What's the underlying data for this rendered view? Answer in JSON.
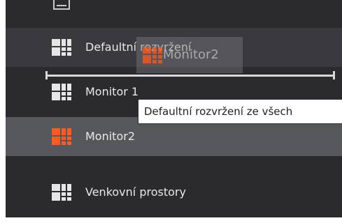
{
  "layouts": [
    {
      "label": "Defaultní rozvržení",
      "icon": "grid-layout-icon",
      "state": "normal"
    },
    {
      "label": "Monitor 1",
      "icon": "grid-layout-icon",
      "state": "normal"
    },
    {
      "label": "Monitor2",
      "icon": "grid-layout-icon",
      "state": "selected"
    },
    {
      "label": "Venkovní prostory",
      "icon": "grid-layout-icon",
      "state": "normal"
    }
  ],
  "drag_ghost": {
    "label": "Monitor2",
    "icon": "grid-layout-icon"
  },
  "tooltip": {
    "text": "Defaultní rozvržení ze všech"
  },
  "colors": {
    "panel": "#2b2b2e",
    "row_alt": "#3a3a3e",
    "row_selected": "#56575b",
    "text": "#e9e9ea",
    "icon_default": "#e6e6e6",
    "icon_active": "#ff5a1f"
  }
}
